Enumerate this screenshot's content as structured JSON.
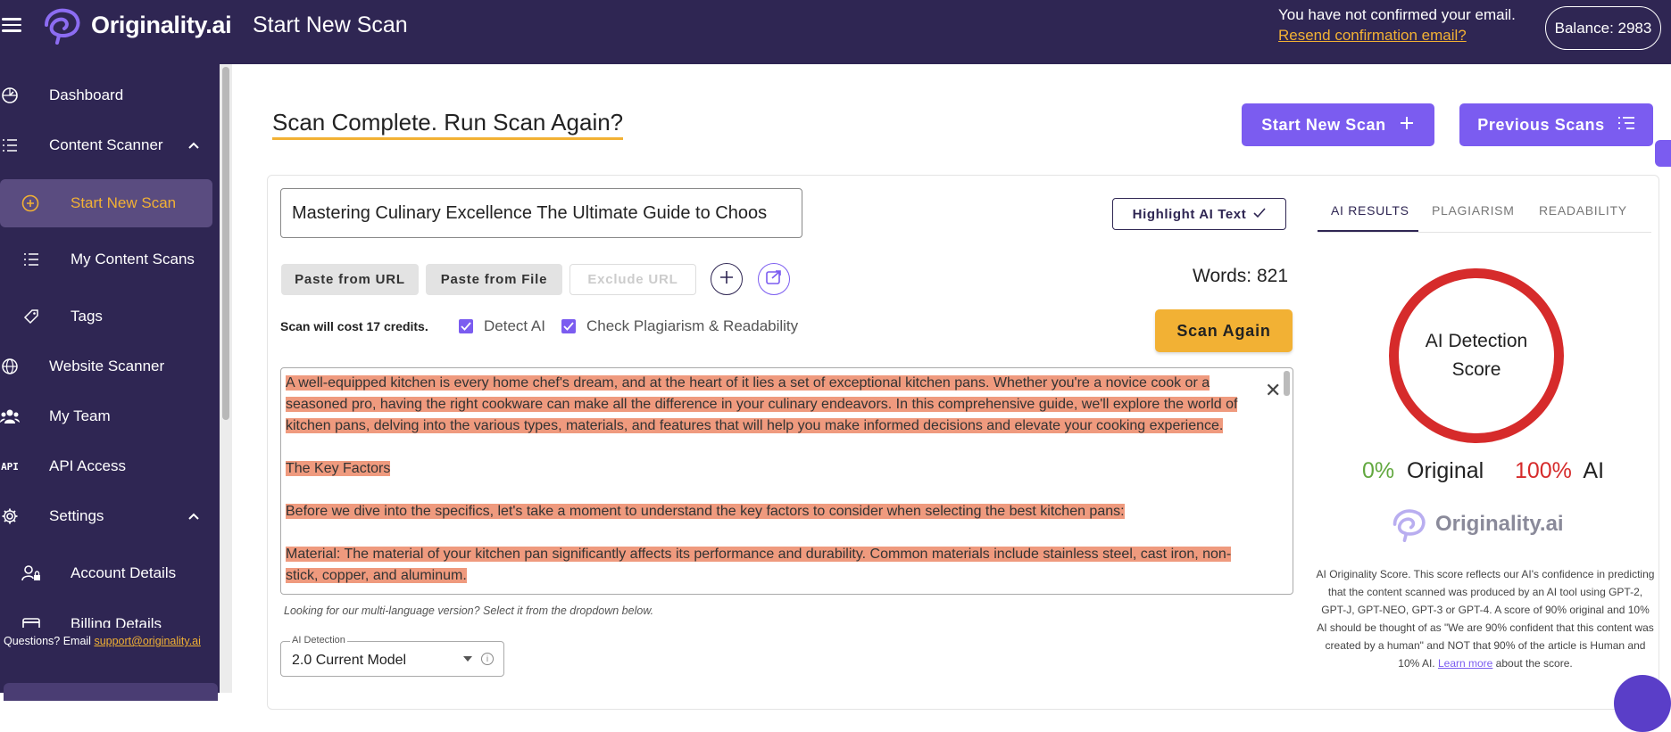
{
  "app": {
    "brand": "Originality.ai",
    "page_heading": "Start New Scan",
    "email_notice": "You have not confirmed your email.",
    "resend_link": "Resend confirmation email?",
    "balance": "Balance: 2983"
  },
  "sidebar": {
    "items": [
      {
        "label": "Dashboard",
        "icon": "dashboard-icon"
      },
      {
        "label": "Content Scanner",
        "icon": "list-icon"
      },
      {
        "label": "Start New Scan",
        "icon": "plus-circle-icon",
        "active": true
      },
      {
        "label": "My Content Scans",
        "icon": "list-icon"
      },
      {
        "label": "Tags",
        "icon": "tag-icon"
      },
      {
        "label": "Website Scanner",
        "icon": "globe-icon"
      },
      {
        "label": "My Team",
        "icon": "team-icon"
      },
      {
        "label": "API Access",
        "icon": "api-icon"
      },
      {
        "label": "Settings",
        "icon": "gear-icon"
      },
      {
        "label": "Account Details",
        "icon": "user-lock-icon"
      },
      {
        "label": "Billing Details",
        "icon": "card-icon"
      }
    ],
    "api_icon_text": "API",
    "questions_text": "Questions? Email ",
    "support_email": "support@originality.ai"
  },
  "main": {
    "scan_title": "Scan Complete. Run Scan Again?",
    "start_new_scan_btn": "Start New Scan",
    "previous_scans_btn": "Previous Scans",
    "title_value": "Mastering Culinary Excellence The Ultimate Guide to Choos",
    "highlight_btn": "Highlight AI Text",
    "paste_url_btn": "Paste from URL",
    "paste_file_btn": "Paste from File",
    "exclude_url_btn": "Exclude URL",
    "words": "Words: 821",
    "cost": "Scan will cost 17 credits.",
    "detect_ai": "Detect AI",
    "check_plag": "Check Plagiarism & Readability",
    "scan_again_btn": "Scan Again",
    "paragraphs": [
      "A well-equipped kitchen is every home chef's dream, and at the heart of it lies a set of exceptional kitchen pans. Whether you're a novice cook or a seasoned pro, having the right cookware can make all the difference in your culinary endeavors. In this comprehensive guide, we'll explore the world of kitchen pans, delving into the various types, materials, and features that will help you make informed decisions and elevate your cooking experience.",
      "The Key Factors",
      "Before we dive into the specifics, let's take a moment to understand the key factors to consider when selecting the best kitchen pans:",
      "Material: The material of your kitchen pan significantly affects its performance and durability. Common materials include stainless steel, cast iron, non-stick, copper, and aluminum."
    ],
    "multi_language_note": "Looking for our multi-language version? Select it from the dropdown below.",
    "model_select_label": "AI Detection",
    "model_select_value": "2.0 Current Model"
  },
  "results": {
    "tabs": [
      "AI RESULTS",
      "PLAGIARISM",
      "READABILITY"
    ],
    "gauge_line1": "AI Detection",
    "gauge_line2": "Score",
    "original_pct": "0%",
    "original_label": "Original",
    "ai_pct": "100%",
    "ai_label": "AI",
    "brand": "Originality.ai",
    "description": "AI Originality Score. This score reflects our AI's confidence in predicting that the content scanned was produced by an AI tool using GPT-2, GPT-J, GPT-NEO, GPT-3 or GPT-4. A score of 90% original and 10% AI should be thought of as \"We are 90% confident that this content was created by a human\" and NOT that 90% of the article is Human and 10% AI. ",
    "learn_more": "Learn more",
    "description_tail": " about the score."
  },
  "colors": {
    "sidebar_bg": "#2f2653",
    "accent_purple": "#7b5cf0",
    "accent_yellow": "#f2b134",
    "ai_red": "#d62b2b",
    "original_green": "#62a83f",
    "highlight": "#ef9a7e"
  }
}
